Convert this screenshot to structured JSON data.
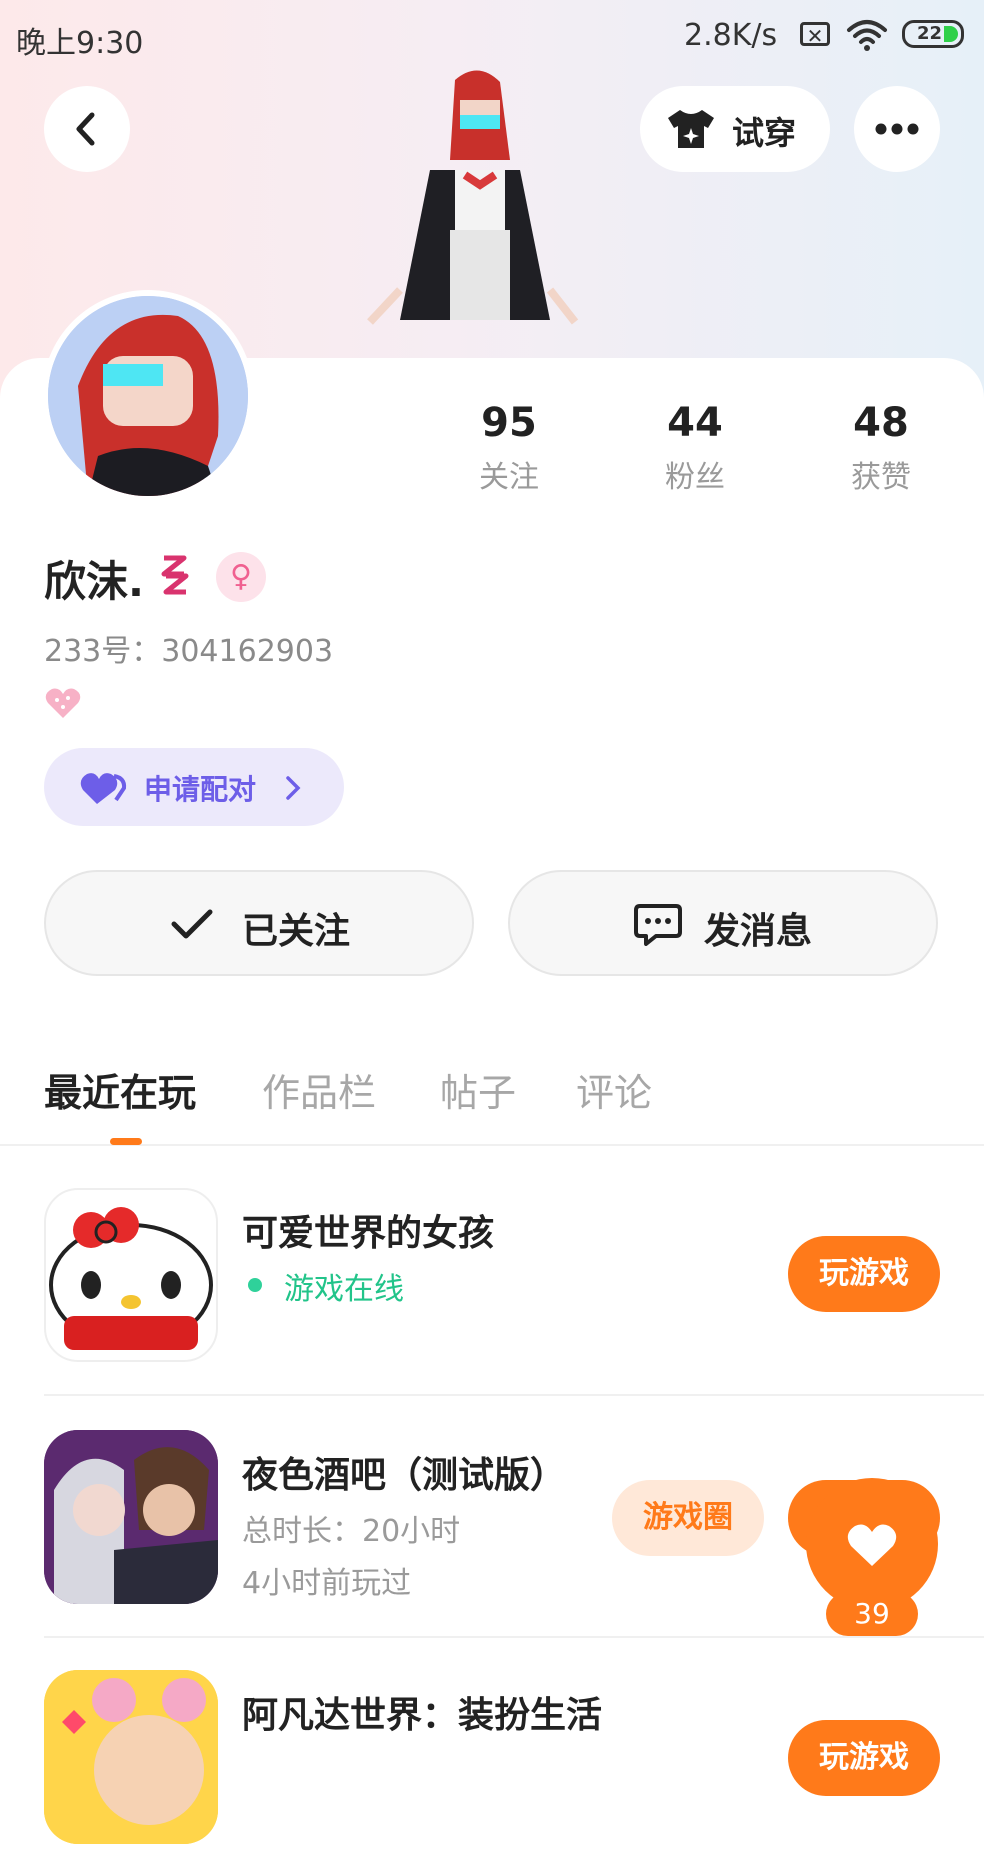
{
  "status_bar": {
    "time": "晚上9:30",
    "network_speed": "2.8K/s",
    "sim_icon": "✕",
    "battery": "22"
  },
  "header": {
    "back_icon": "chevron-left",
    "try_on_label": "试穿",
    "more_icon": "more-dots"
  },
  "profile": {
    "stats": [
      {
        "value": "95",
        "label": "关注"
      },
      {
        "value": "44",
        "label": "粉丝"
      },
      {
        "value": "48",
        "label": "获赞"
      }
    ],
    "name": "欣沫.",
    "gender_symbol": "♀",
    "uid": "233号：304162903",
    "pair_label": "申请配对",
    "follow_label": "已关注",
    "message_label": "发消息"
  },
  "tabs": [
    "最近在玩",
    "作品栏",
    "帖子",
    "评论"
  ],
  "games": [
    {
      "title": "可爱世界的女孩",
      "meta1": "游戏在线",
      "meta2": "",
      "action": "玩游戏"
    },
    {
      "title": "夜色酒吧（测试版）",
      "meta1": "总时长：20小时",
      "meta2": "4小时前玩过",
      "action": "游戏圈"
    },
    {
      "title": "阿凡达世界：装扮生活",
      "meta1": "",
      "meta2": "",
      "action": "玩游戏"
    }
  ],
  "like_count": "39",
  "colors": {
    "accent": "#ff7a1a",
    "pair": "#6d5ee8",
    "online": "#22c48a"
  }
}
